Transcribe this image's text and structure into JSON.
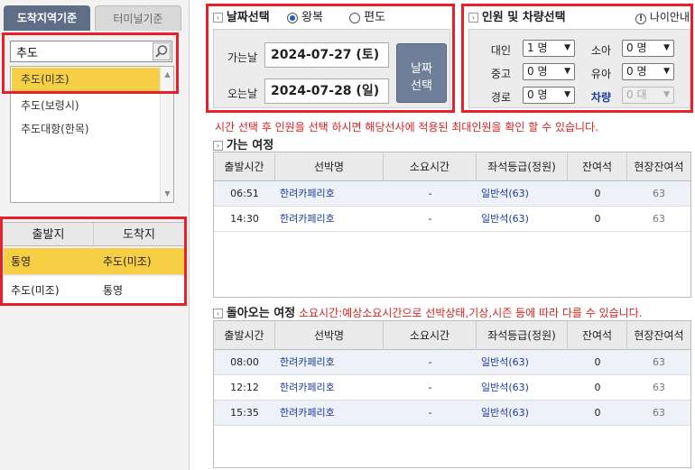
{
  "tabs": {
    "active": "도착지역기준",
    "inactive": "터미널기준"
  },
  "search": {
    "value": "추도"
  },
  "port_list": [
    "추도(미조)",
    "추도(보령시)",
    "추도대항(한목)"
  ],
  "route_table": {
    "headers": [
      "출발지",
      "도착지"
    ],
    "rows": [
      {
        "from": "통영",
        "to": "추도(미조)"
      },
      {
        "from": "추도(미조)",
        "to": "통영"
      }
    ]
  },
  "date_section": {
    "title": "날짜선택",
    "round_trip": "왕복",
    "one_way": "편도",
    "go_label": "가는날",
    "go_value": "2024-07-27 (토)",
    "return_label": "오는날",
    "return_value": "2024-07-28 (일)",
    "button_line1": "날짜",
    "button_line2": "선택"
  },
  "pax_section": {
    "title": "인원 및 차량선택",
    "age_guide": "나이안내",
    "adult_label": "대인",
    "adult_value": "1 명",
    "child_label": "소아",
    "child_value": "0 명",
    "teen_label": "중고",
    "teen_value": "0 명",
    "infant_label": "유아",
    "infant_value": "0 명",
    "senior_label": "경로",
    "senior_value": "0 명",
    "vehicle_label": "차량",
    "vehicle_value": "0 대"
  },
  "notice": "시간 선택 후 인원을 선택 하시면 해당선사에 적용된 최대인원을 확인 할 수 있습니다.",
  "outbound": {
    "title": "가는 여정",
    "headers": [
      "출발시간",
      "선박명",
      "소요시간",
      "좌석등급(정원)",
      "잔여석",
      "현장잔여석"
    ],
    "rows": [
      {
        "time": "06:51",
        "ship": "한려카페리호",
        "duration": "-",
        "grade": "일반석(63)",
        "remain": "0",
        "onsite": "63"
      },
      {
        "time": "14:30",
        "ship": "한려카페리호",
        "duration": "-",
        "grade": "일반석(63)",
        "remain": "0",
        "onsite": "63"
      }
    ]
  },
  "return_trip": {
    "title": "돌아오는 여정",
    "note": "소요시간:예상소요시간으로 선박상태,기상,시즌 등에 따라 다를 수 있습니다.",
    "headers": [
      "출발시간",
      "선박명",
      "소요시간",
      "좌석등급(정원)",
      "잔여석",
      "현장잔여석"
    ],
    "rows": [
      {
        "time": "08:00",
        "ship": "한려카페리호",
        "duration": "-",
        "grade": "일반석(63)",
        "remain": "0",
        "onsite": "63"
      },
      {
        "time": "12:12",
        "ship": "한려카페리호",
        "duration": "-",
        "grade": "일반석(63)",
        "remain": "0",
        "onsite": "63"
      },
      {
        "time": "15:35",
        "ship": "한려카페리호",
        "duration": "-",
        "grade": "일반석(63)",
        "remain": "0",
        "onsite": "63"
      }
    ]
  },
  "colors": {
    "highlight": "#f7cf45",
    "annotation_red": "#e8202a",
    "tab_active": "#5f6e86",
    "link_blue": "#1a3c9c"
  }
}
